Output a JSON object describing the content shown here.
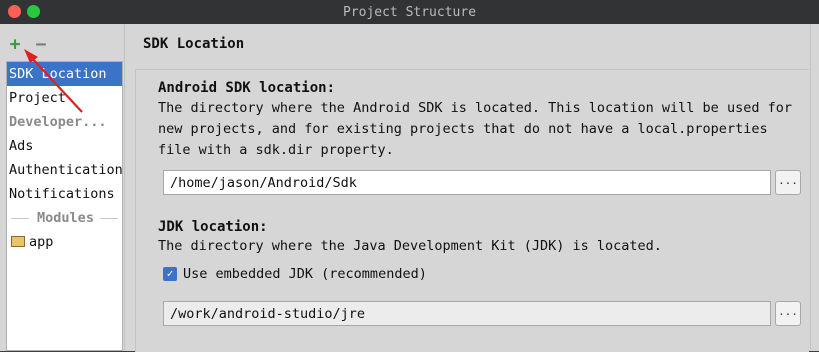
{
  "window": {
    "title": "Project Structure",
    "colors": {
      "close": "#ff5f57",
      "maximize": "#28c840",
      "selection": "#3b74c7",
      "annotation_arrow": "#e02020"
    }
  },
  "toolbar": {
    "add_icon": "+",
    "remove_icon": "−"
  },
  "sidebar": {
    "items": [
      {
        "label": "SDK Location",
        "selected": true,
        "kind": "item"
      },
      {
        "label": "Project",
        "kind": "item"
      },
      {
        "label": "Developer...",
        "kind": "category"
      },
      {
        "label": "Ads",
        "kind": "item"
      },
      {
        "label": "Authentication",
        "kind": "item"
      },
      {
        "label": "Notifications",
        "kind": "item"
      },
      {
        "label": "Modules",
        "kind": "section"
      },
      {
        "label": "app",
        "kind": "module",
        "icon": "folder-module-icon"
      }
    ]
  },
  "main": {
    "title": "SDK Location",
    "android_sdk": {
      "heading": "Android SDK location:",
      "description": [
        "The directory where the Android SDK is located. This location will be used for",
        "new projects, and for existing projects that do not have a local.properties",
        "file with a sdk.dir property."
      ],
      "path": "/home/jason/Android/Sdk",
      "browse_label": "..."
    },
    "jdk": {
      "heading": "JDK location:",
      "description": "The directory where the Java Development Kit (JDK) is located.",
      "use_embedded_label": "Use embedded JDK (recommended)",
      "use_embedded_checked": true,
      "path": "/work/android-studio/jre",
      "browse_label": "..."
    }
  }
}
